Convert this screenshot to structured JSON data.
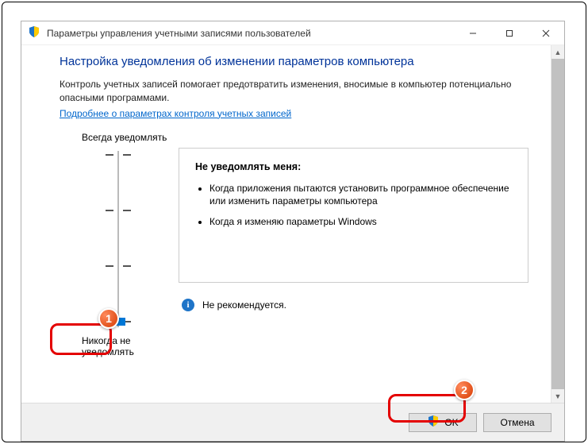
{
  "window": {
    "title": "Параметры управления учетными записями пользователей"
  },
  "heading": "Настройка уведомления об изменении параметров компьютера",
  "description": "Контроль учетных записей помогает предотвратить изменения, вносимые в компьютер потенциально опасными программами.",
  "link": "Подробнее о параметрах контроля учетных записей",
  "slider": {
    "top_label": "Всегда уведомлять",
    "bottom_label": "Никогда не уведомлять",
    "levels": 4,
    "current_level": 0
  },
  "panel": {
    "title": "Не уведомлять меня:",
    "items": [
      "Когда приложения пытаются установить программное обеспечение или изменить параметры компьютера",
      "Когда я изменяю параметры Windows"
    ]
  },
  "recommendation": "Не рекомендуется.",
  "buttons": {
    "ok": "OK",
    "cancel": "Отмена"
  },
  "callouts": {
    "one": "1",
    "two": "2"
  }
}
